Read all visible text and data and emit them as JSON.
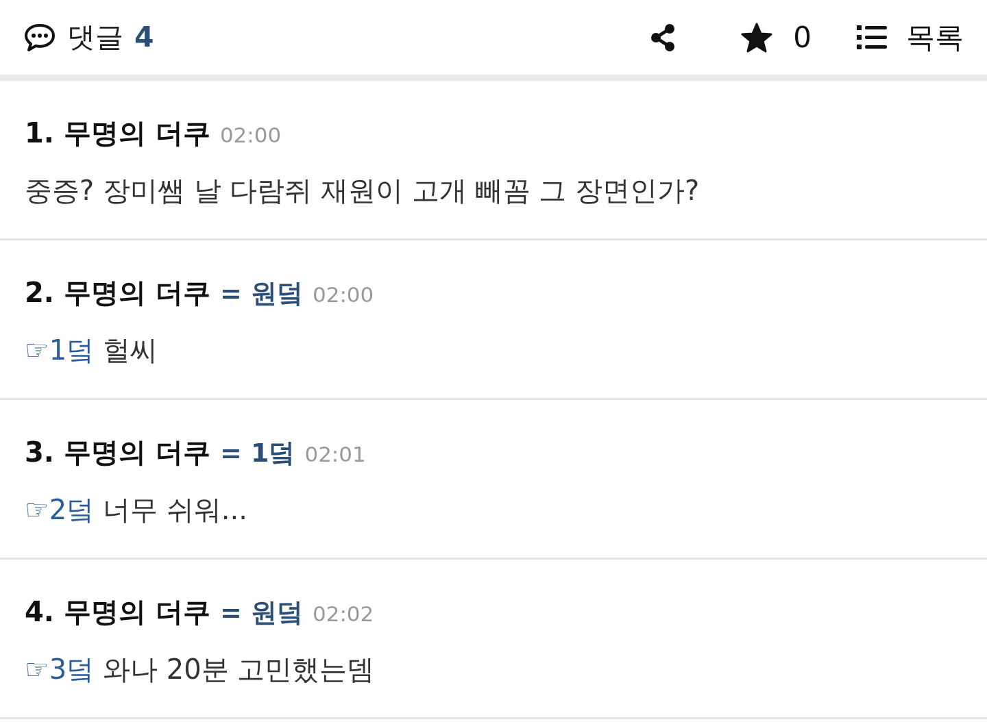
{
  "header": {
    "title": "댓글",
    "count": "4",
    "star_count": "0",
    "list_label": "목록"
  },
  "comments": [
    {
      "number": "1.",
      "author": "무명의 더쿠",
      "time": "02:00",
      "text": "중증? 장미쌤 날 다람쥐 재원이 고개 빼꼼 그 장면인가?"
    },
    {
      "number": "2.",
      "author": "무명의 더쿠",
      "reply_to": "= 원덬",
      "time": "02:00",
      "ref": "☞1덬",
      "text": "헐씨"
    },
    {
      "number": "3.",
      "author": "무명의 더쿠",
      "reply_to": "= 1덬",
      "time": "02:01",
      "ref": "☞2덬",
      "text": "너무 쉬워..."
    },
    {
      "number": "4.",
      "author": "무명의 더쿠",
      "reply_to": "= 원덬",
      "time": "02:02",
      "ref": "☞3덬",
      "text": "와나 20분 고민했는뎀"
    }
  ]
}
